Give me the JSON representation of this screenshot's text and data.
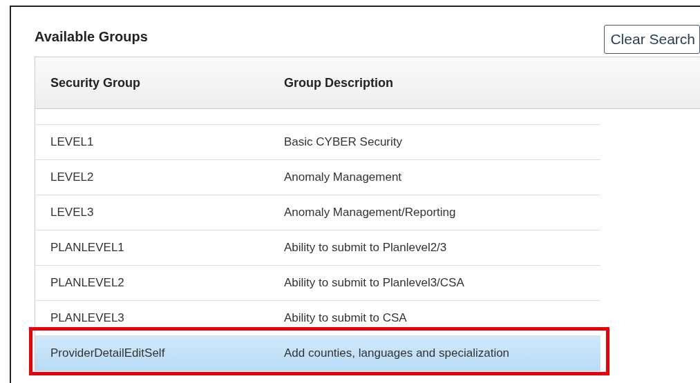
{
  "title": "Available Groups",
  "clear_button": "Clear Search",
  "table": {
    "columns": [
      "Security Group",
      "Group Description"
    ],
    "rows": [
      {
        "group": "LEVEL1",
        "description": "Basic CYBER Security",
        "selected": false,
        "highlighted": false
      },
      {
        "group": "LEVEL2",
        "description": "Anomaly Management",
        "selected": false,
        "highlighted": false
      },
      {
        "group": "LEVEL3",
        "description": "Anomaly Management/Reporting",
        "selected": false,
        "highlighted": false
      },
      {
        "group": "PLANLEVEL1",
        "description": "Ability to submit to Planlevel2/3",
        "selected": false,
        "highlighted": false
      },
      {
        "group": "PLANLEVEL2",
        "description": "Ability to submit to Planlevel3/CSA",
        "selected": false,
        "highlighted": false
      },
      {
        "group": "PLANLEVEL3",
        "description": "Ability to submit to CSA",
        "selected": false,
        "highlighted": false
      },
      {
        "group": "ProviderDetailEditSelf",
        "description": "Add counties, languages and specialization",
        "selected": true,
        "highlighted": true
      }
    ]
  }
}
